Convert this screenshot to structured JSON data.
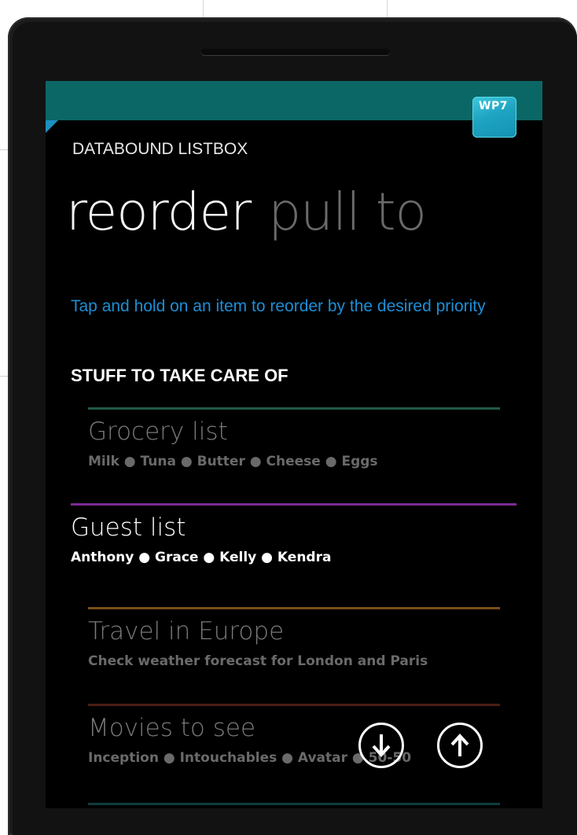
{
  "app": {
    "title": "DATABOUND LISTBOX",
    "badge": "WP7"
  },
  "pivot": {
    "active": "reorder",
    "next": "pull to"
  },
  "hint": "Tap and hold on an item to reorder by the desired priority",
  "section_title": "STUFF TO TAKE CARE OF",
  "items": [
    {
      "title": "Grocery list",
      "detail": "Milk ● Tuna ● Butter ● Cheese ● Eggs",
      "accent": "#1f5a47",
      "state": "dim"
    },
    {
      "title": "Guest list",
      "detail": "Anthony ● Grace ● Kelly ● Kendra",
      "accent": "#7b2a94",
      "state": "lifted"
    },
    {
      "title": "Travel in Europe",
      "detail": "Check weather forecast for London and Paris",
      "accent": "#7a4e1c",
      "state": "dim"
    },
    {
      "title": "Movies to see",
      "detail": "Inception ● Intouchables ● Avatar ● 50-50",
      "accent": "#4a1e14",
      "state": "dim"
    }
  ],
  "app_bar": {
    "move_down_icon": "arrow-down-circle",
    "move_up_icon": "arrow-up-circle"
  },
  "colors": {
    "title_bar": "#0b6766",
    "hint_text": "#1c8fd6",
    "screen_bg": "#000000"
  }
}
